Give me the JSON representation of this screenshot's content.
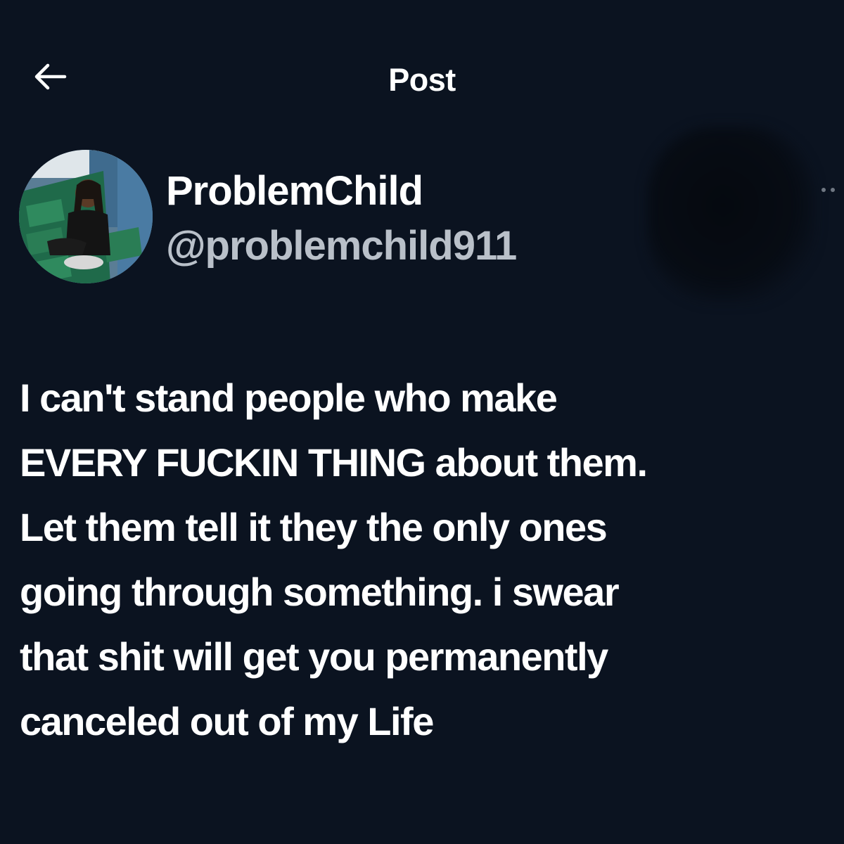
{
  "header": {
    "back_icon": "arrow-left-icon",
    "title": "Post"
  },
  "author": {
    "name": "ProblemChild",
    "handle": "@problemchild911",
    "avatar_description_icon": "avatar-photo"
  },
  "more_icon": "more-dots-icon",
  "post": {
    "lines": [
      "I can't stand people who make",
      "EVERY FUCKIN THING about them.",
      "Let them tell it they the only ones",
      "going through something. i swear",
      "that shit will get you permanently",
      "canceled out of my Life"
    ]
  },
  "colors": {
    "background": "#0b1320",
    "text": "#ffffff",
    "handle": "#b9c0c9"
  }
}
